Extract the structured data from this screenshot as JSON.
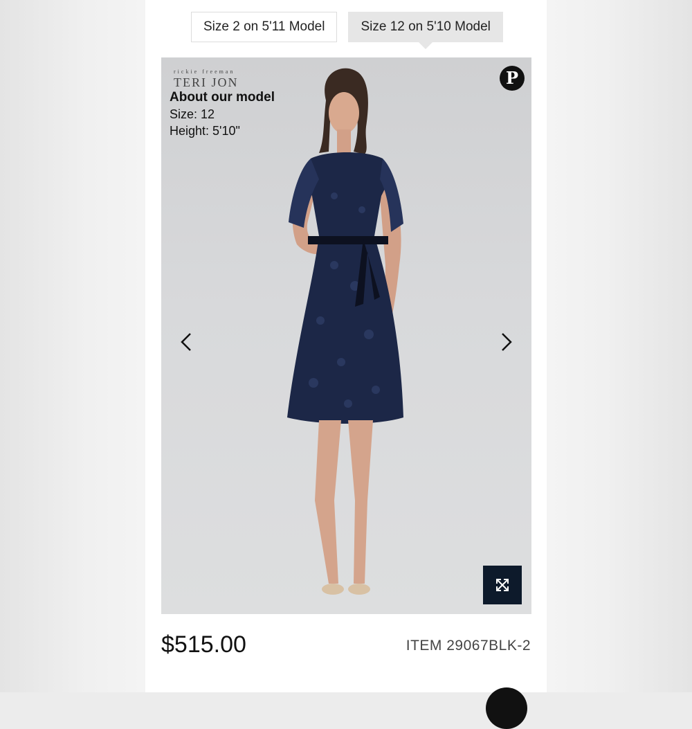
{
  "size_tabs": [
    {
      "label": "Size 2 on 5'11 Model",
      "active": false
    },
    {
      "label": "Size 12 on 5'10 Model",
      "active": true
    }
  ],
  "gallery": {
    "brand_small": "rickie freeman",
    "brand_big": "TERI JON",
    "about_heading": "About our model",
    "about_size": "Size: 12",
    "about_height": "Height: 5'10\"",
    "pinterest_icon": "pinterest-icon",
    "prev_icon": "chevron-left-icon",
    "next_icon": "chevron-right-icon",
    "expand_icon": "expand-arrows-icon",
    "dress_color": "#1c2747",
    "background_color": "#d6d7d9"
  },
  "product": {
    "price": "$515.00",
    "item_code": "ITEM 29067BLK-2"
  }
}
